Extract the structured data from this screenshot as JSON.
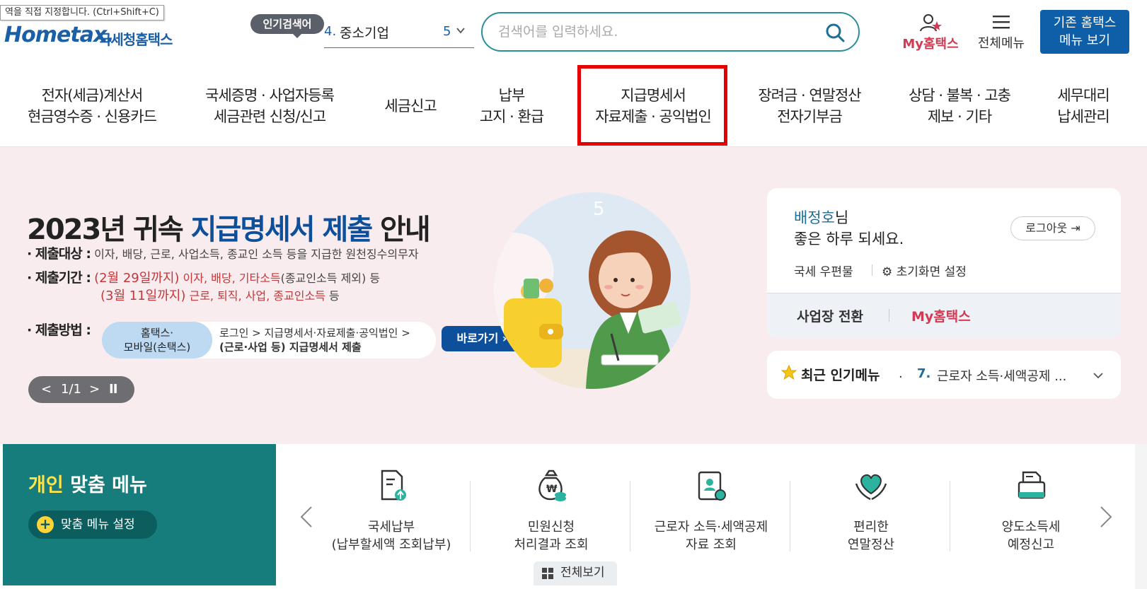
{
  "tooltip": "역을 직접 지정합니다. (Ctrl+Shift+C)",
  "logo": {
    "brand": "Hometax.",
    "name_kr": "국세청홈택스"
  },
  "popular": {
    "badge": "인기검색어",
    "num": "4.",
    "text": "중소기업",
    "right_num": "5"
  },
  "search": {
    "placeholder": "검색어를 입력하세요."
  },
  "header": {
    "my_label": "My홈택스",
    "menu_label": "전체메뉴",
    "old_line1": "기존 홈택스",
    "old_line2": "메뉴 보기"
  },
  "nav": [
    {
      "l1": "전자(세금)계산서",
      "l2": "현금영수증 · 신용카드"
    },
    {
      "l1": "국세증명 · 사업자등록",
      "l2": "세금관련 신청/신고"
    },
    {
      "l1": "세금신고",
      "l2": ""
    },
    {
      "l1": "납부",
      "l2": "고지 · 환급"
    },
    {
      "l1": "지급명세서",
      "l2": "자료제출 · 공익법인"
    },
    {
      "l1": "장려금 · 연말정산",
      "l2": "전자기부금"
    },
    {
      "l1": "상담 · 불복 · 고충",
      "l2": "제보 · 기타"
    },
    {
      "l1": "세무대리",
      "l2": "납세관리"
    }
  ],
  "hero": {
    "title_a": "2023년 귀속 ",
    "title_hl": "지급명세서 제출",
    "title_b": " 안내",
    "target_label": "· 제출대상 :",
    "target_text": "이자, 배당, 근로, 사업소득, 종교인 소득 등을 지급한 원천징수의무자",
    "period_label": "· 제출기간 :",
    "period1_red": "(2월 29일까지)",
    "period1_text": "이자, 배당, 기타소득",
    "period1_paren": "(종교인소득 제외)",
    "period1_tail": " 등",
    "period2_red": "(3월 11일까지)",
    "period2_text": "근로, 퇴직, 사업, 종교인소득",
    "period2_tail": " 등",
    "method_label": "· 제출방법 :",
    "method_chip1": "홈택스·",
    "method_chip2": "모바일(손택스)",
    "method_path1": "로그인 > 지급명세서·자료제출·공익법인 >",
    "method_path2": "(근로·사업 등) 지급명세서 제출",
    "shortcut": "바로가기",
    "pager": {
      "prev": "<",
      "num": "1/1",
      "next": ">",
      "pause": "II"
    }
  },
  "user": {
    "name": "배정호",
    "suffix": "님",
    "greeting": "좋은 하루 되세요.",
    "logout": "로그아웃",
    "mail": "국세 우편물",
    "settings": "초기화면 설정",
    "switch": "사업장 전환",
    "my": "My홈택스"
  },
  "recent": {
    "label": "최근 인기메뉴",
    "dot": ".",
    "num": "7.",
    "item": "근로자 소득·세액공제 ..."
  },
  "custom": {
    "title_y": "개인",
    "title_w": " 맞춤 메뉴",
    "setting": "맞춤 메뉴 설정",
    "view_all": "전체보기",
    "items": [
      {
        "l1": "국세납부",
        "l2": "(납부할세액 조회납부)"
      },
      {
        "l1": "민원신청",
        "l2": "처리결과 조회"
      },
      {
        "l1": "근로자 소득·세액공제",
        "l2": "자료 조회"
      },
      {
        "l1": "편리한",
        "l2": "연말정산"
      },
      {
        "l1": "양도소득세",
        "l2": "예정신고"
      }
    ]
  },
  "colors": {
    "teal": "#167c7c",
    "blue": "#0e4f9c",
    "red_accent": "#d03a52",
    "highlight": "#e40000"
  }
}
